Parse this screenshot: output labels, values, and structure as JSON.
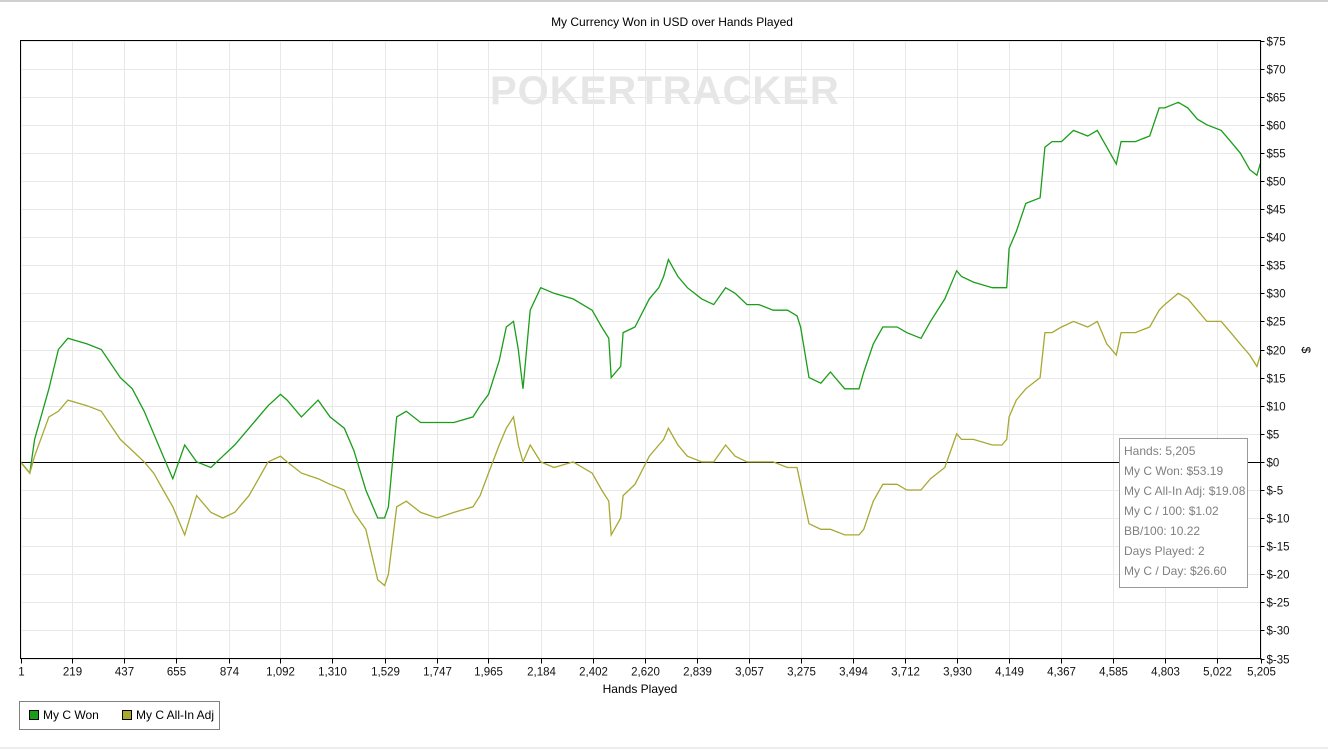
{
  "chart_data": {
    "type": "line",
    "title": "My Currency Won in USD over Hands Played",
    "xlabel": "Hands Played",
    "ylabel": "$",
    "xlim": [
      1,
      5205
    ],
    "ylim": [
      -35,
      75
    ],
    "x_ticks": [
      "1",
      "219",
      "437",
      "655",
      "874",
      "1,092",
      "1,310",
      "1,529",
      "1,747",
      "1,965",
      "2,184",
      "2,402",
      "2,620",
      "2,839",
      "3,057",
      "3,275",
      "3,494",
      "3,712",
      "3,930",
      "4,149",
      "4,367",
      "4,585",
      "4,803",
      "5,022",
      "5,205"
    ],
    "x_tick_values": [
      1,
      219,
      437,
      655,
      874,
      1092,
      1310,
      1529,
      1747,
      1965,
      2184,
      2402,
      2620,
      2839,
      3057,
      3275,
      3494,
      3712,
      3930,
      4149,
      4367,
      4585,
      4803,
      5022,
      5205
    ],
    "y_ticks": [
      "$75",
      "$70",
      "$65",
      "$60",
      "$55",
      "$50",
      "$45",
      "$40",
      "$35",
      "$30",
      "$25",
      "$20",
      "$15",
      "$10",
      "$5",
      "$0",
      "$-5",
      "$-10",
      "$-15",
      "$-20",
      "$-25",
      "$-30",
      "$-35"
    ],
    "y_tick_values": [
      75,
      70,
      65,
      60,
      55,
      50,
      45,
      40,
      35,
      30,
      25,
      20,
      15,
      10,
      5,
      0,
      -5,
      -10,
      -15,
      -20,
      -25,
      -30,
      -35
    ],
    "grid": true,
    "legend_position": "bottom-left",
    "watermark": "POKERTRACKER",
    "series": [
      {
        "name": "My C Won",
        "color": "#1a9e1a",
        "x": [
          1,
          40,
          60,
          120,
          160,
          200,
          280,
          340,
          420,
          470,
          520,
          560,
          600,
          640,
          690,
          740,
          800,
          850,
          900,
          960,
          1040,
          1092,
          1120,
          1180,
          1250,
          1300,
          1360,
          1400,
          1450,
          1500,
          1529,
          1545,
          1580,
          1620,
          1680,
          1750,
          1820,
          1900,
          1930,
          1965,
          2010,
          2040,
          2070,
          2090,
          2110,
          2140,
          2184,
          2240,
          2320,
          2400,
          2440,
          2470,
          2480,
          2520,
          2530,
          2580,
          2640,
          2680,
          2700,
          2720,
          2760,
          2800,
          2860,
          2910,
          2960,
          3000,
          3050,
          3100,
          3160,
          3220,
          3260,
          3275,
          3310,
          3360,
          3400,
          3460,
          3520,
          3540,
          3580,
          3620,
          3680,
          3720,
          3780,
          3820,
          3880,
          3930,
          3950,
          4000,
          4080,
          4120,
          4140,
          4150,
          4180,
          4220,
          4280,
          4300,
          4330,
          4370,
          4420,
          4480,
          4520,
          4560,
          4600,
          4620,
          4680,
          4740,
          4780,
          4803,
          4860,
          4900,
          4940,
          4980,
          5040,
          5080,
          5120,
          5160,
          5190,
          5205
        ],
        "values": [
          0,
          -2,
          4,
          13,
          20,
          22,
          21,
          20,
          15,
          13,
          9,
          5,
          1,
          -3,
          3,
          0,
          -1,
          1,
          3,
          6,
          10,
          12,
          11,
          8,
          11,
          8,
          6,
          2,
          -5,
          -10,
          -10,
          -8,
          8,
          9,
          7,
          7,
          7,
          8,
          10,
          12,
          18,
          24,
          25,
          20,
          13,
          27,
          31,
          30,
          29,
          27,
          24,
          22,
          15,
          17,
          23,
          24,
          29,
          31,
          33,
          36,
          33,
          31,
          29,
          28,
          31,
          30,
          28,
          28,
          27,
          27,
          26,
          24,
          15,
          14,
          16,
          13,
          13,
          16,
          21,
          24,
          24,
          23,
          22,
          25,
          29,
          34,
          33,
          32,
          31,
          31,
          31,
          38,
          41,
          46,
          47,
          56,
          57,
          57,
          59,
          58,
          59,
          56,
          53,
          57,
          57,
          58,
          63,
          63,
          64,
          63,
          61,
          60,
          59,
          57,
          55,
          52,
          51,
          53.19
        ]
      },
      {
        "name": "My C All-In Adj",
        "color": "#a8a832",
        "x": [
          1,
          40,
          60,
          120,
          160,
          200,
          280,
          340,
          420,
          470,
          520,
          560,
          600,
          640,
          690,
          740,
          800,
          850,
          900,
          960,
          1040,
          1092,
          1120,
          1180,
          1250,
          1300,
          1360,
          1400,
          1450,
          1500,
          1529,
          1545,
          1580,
          1620,
          1680,
          1750,
          1820,
          1900,
          1930,
          1965,
          2010,
          2040,
          2070,
          2090,
          2110,
          2140,
          2184,
          2240,
          2320,
          2400,
          2440,
          2470,
          2480,
          2520,
          2530,
          2580,
          2640,
          2680,
          2700,
          2720,
          2760,
          2800,
          2860,
          2910,
          2960,
          3000,
          3050,
          3100,
          3160,
          3220,
          3260,
          3275,
          3310,
          3360,
          3400,
          3460,
          3520,
          3540,
          3580,
          3620,
          3680,
          3720,
          3780,
          3820,
          3880,
          3930,
          3950,
          4000,
          4080,
          4120,
          4140,
          4150,
          4180,
          4220,
          4280,
          4300,
          4330,
          4370,
          4420,
          4480,
          4520,
          4560,
          4600,
          4620,
          4680,
          4740,
          4780,
          4803,
          4860,
          4900,
          4940,
          4980,
          5040,
          5080,
          5120,
          5160,
          5190,
          5205
        ],
        "values": [
          0,
          -2,
          1,
          8,
          9,
          11,
          10,
          9,
          4,
          2,
          0,
          -2,
          -5,
          -8,
          -13,
          -6,
          -9,
          -10,
          -9,
          -6,
          0,
          1,
          0,
          -2,
          -3,
          -4,
          -5,
          -9,
          -12,
          -21,
          -22,
          -20,
          -8,
          -7,
          -9,
          -10,
          -9,
          -8,
          -6,
          -2,
          3,
          6,
          8,
          3,
          0,
          3,
          0,
          -1,
          0,
          -2,
          -5,
          -7,
          -13,
          -10,
          -6,
          -4,
          1,
          3,
          4,
          6,
          3,
          1,
          0,
          0,
          3,
          1,
          0,
          0,
          0,
          -1,
          -1,
          -4,
          -11,
          -12,
          -12,
          -13,
          -13,
          -12,
          -7,
          -4,
          -4,
          -5,
          -5,
          -3,
          -1,
          5,
          4,
          4,
          3,
          3,
          4,
          8,
          11,
          13,
          15,
          23,
          23,
          24,
          25,
          24,
          25,
          21,
          19,
          23,
          23,
          24,
          27,
          28,
          30,
          29,
          27,
          25,
          25,
          23,
          21,
          19,
          17,
          19.08
        ]
      }
    ],
    "stats_box": [
      "Hands: 5,205",
      "My C Won: $53.19",
      "My C All-In Adj: $19.08",
      "My C / 100: $1.02",
      "BB/100: 10.22",
      "Days Played: 2",
      "My C / Day: $26.60"
    ]
  }
}
